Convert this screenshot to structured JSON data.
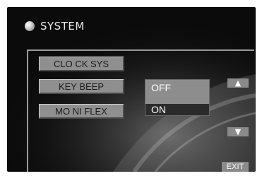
{
  "header": {
    "title": "SYSTEM",
    "icon": "disc-icon"
  },
  "menu": {
    "items": [
      {
        "label": "CLO CK SYS"
      },
      {
        "label": "KEY BEEP"
      },
      {
        "label": "MO NI FLEX"
      }
    ],
    "selected_index": 1
  },
  "dropdown": {
    "options": [
      "OFF",
      "ON"
    ],
    "selected": "OFF"
  },
  "nav": {
    "up_icon": "arrow-up-icon",
    "down_icon": "arrow-down-icon",
    "exit_label": "EXIT"
  },
  "colors": {
    "background": "#0b0b0b",
    "button_gray": "#8f8f8f",
    "text_light": "#ffffff"
  }
}
